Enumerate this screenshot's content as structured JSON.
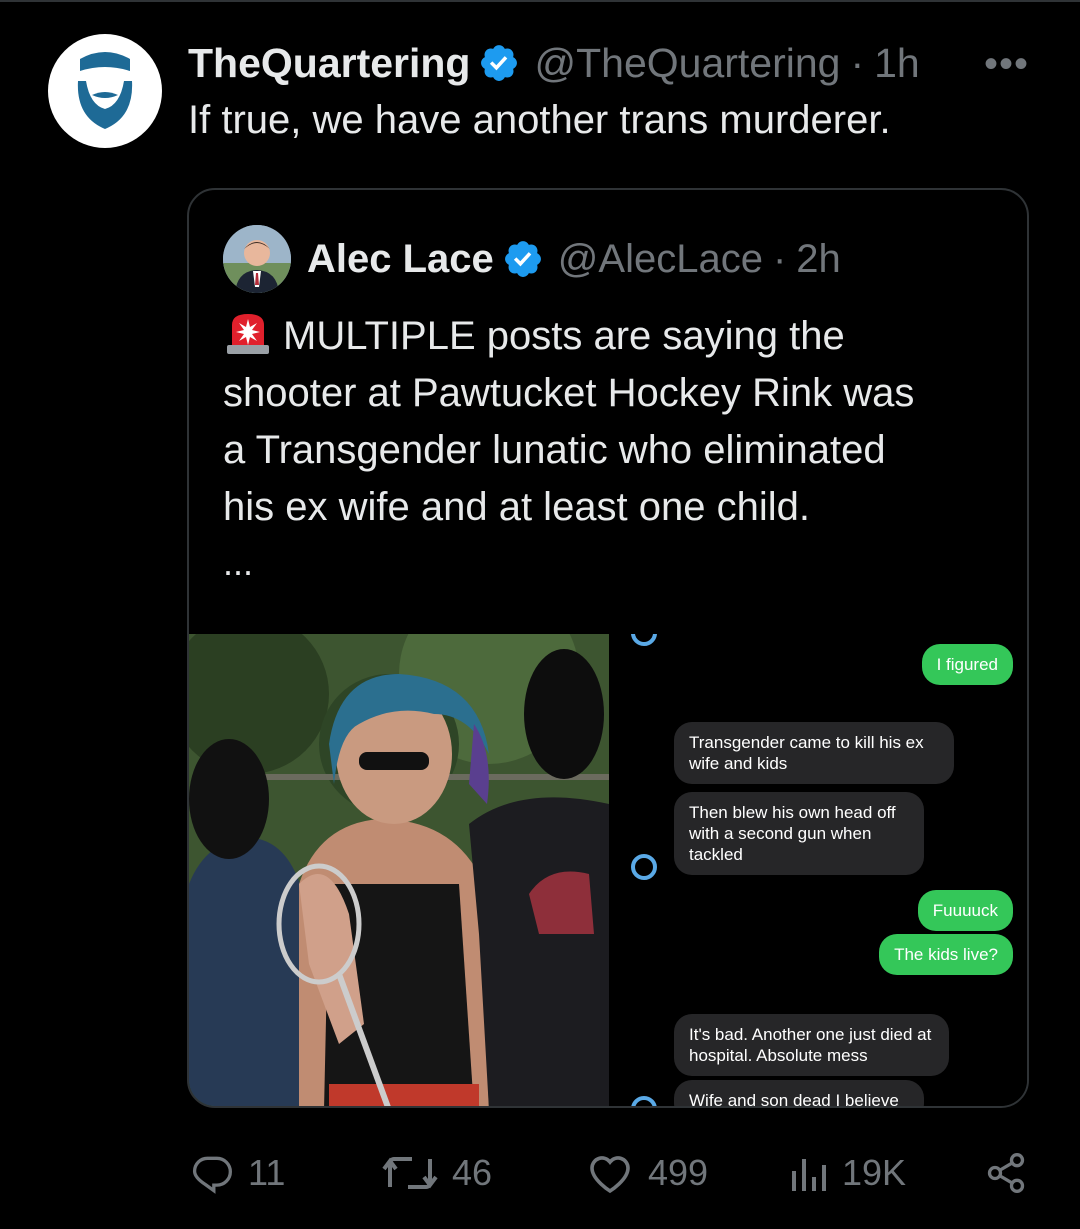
{
  "tweet": {
    "display_name": "TheQuartering",
    "handle": "@TheQuartering",
    "separator": "·",
    "time": "1h",
    "more": "•••",
    "text": "If true, we have another trans murderer."
  },
  "quoted": {
    "display_name": "Alec Lace",
    "handle": "@AlecLace",
    "separator": "·",
    "time": "2h",
    "emoji": "🚨",
    "lines": [
      "MULTIPLE posts are saying the",
      "shooter at Pawtucket Hockey Rink was",
      "a Transgender lunatic who eliminated",
      "his ex wife and at least one child."
    ],
    "more_indicator": "...",
    "chat_messages": [
      {
        "side": "sent",
        "text": "I figured"
      },
      {
        "side": "recv",
        "text": "Transgender came to kill his ex wife and kids"
      },
      {
        "side": "recv",
        "text": "Then blew his own head off with a second gun when tackled"
      },
      {
        "side": "sent",
        "text": "Fuuuuck"
      },
      {
        "side": "sent",
        "text": "The kids live?"
      },
      {
        "side": "recv",
        "text": "It's bad. Another one just died at hospital. Absolute mess"
      },
      {
        "side": "recv",
        "text": "Wife and son dead I believe"
      }
    ]
  },
  "actions": {
    "replies": "11",
    "reposts": "46",
    "likes": "499",
    "views": "19K"
  },
  "colors": {
    "background": "#000000",
    "text": "#e7e9ea",
    "muted": "#71767b",
    "verified": "#1d9bf0",
    "border": "#2f3336",
    "sent_bubble": "#34c759",
    "received_bubble": "#262628"
  },
  "icons": {
    "verified": "verified-badge-icon",
    "reply": "reply-icon",
    "repost": "repost-icon",
    "like": "heart-icon",
    "views": "views-icon",
    "share": "share-icon"
  }
}
